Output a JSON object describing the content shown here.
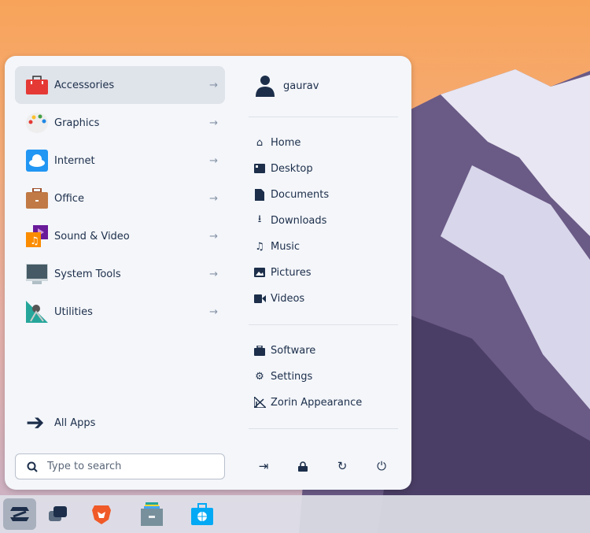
{
  "categories": [
    {
      "label": "Accessories",
      "icon": "toolbox-icon",
      "active": true
    },
    {
      "label": "Graphics",
      "icon": "palette-icon"
    },
    {
      "label": "Internet",
      "icon": "cloud-icon"
    },
    {
      "label": "Office",
      "icon": "briefcase-icon"
    },
    {
      "label": "Sound & Video",
      "icon": "music-video-icon"
    },
    {
      "label": "System Tools",
      "icon": "monitor-icon"
    },
    {
      "label": "Utilities",
      "icon": "utilities-icon"
    }
  ],
  "all_apps": "All Apps",
  "search": {
    "placeholder": "Type to search"
  },
  "user": {
    "name": "gaurav"
  },
  "places": [
    {
      "label": "Home"
    },
    {
      "label": "Desktop"
    },
    {
      "label": "Documents"
    },
    {
      "label": "Downloads"
    },
    {
      "label": "Music"
    },
    {
      "label": "Pictures"
    },
    {
      "label": "Videos"
    }
  ],
  "system": [
    {
      "label": "Software"
    },
    {
      "label": "Settings"
    },
    {
      "label": "Zorin Appearance"
    }
  ],
  "taskbar": [
    "zorin-menu",
    "workspaces",
    "brave-browser",
    "files",
    "software-store"
  ]
}
